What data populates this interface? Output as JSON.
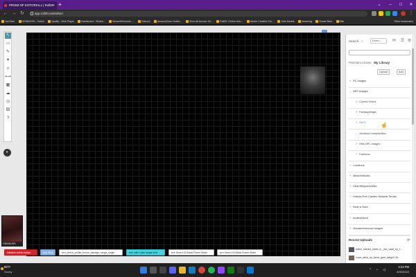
{
  "browser": {
    "tab_title": "PRISM OF KOTORIALL | Roll20",
    "tab_close": "×",
    "new_tab": "+",
    "url": "app.roll20.net/editor/",
    "window_controls": [
      "⌄",
      "–",
      "□",
      "✕"
    ],
    "nav": [
      "←",
      "→",
      "↻"
    ],
    "bookmarks": [
      "YouTube",
      "ODINKUSH - Twitch",
      "Spotify - Web Player",
      "Dashboard - Redea...",
      "StreamElements -...",
      "Discord",
      "AmazonZone Online...",
      "Xbox All Access Xb...",
      "Roll20: Online virtu...",
      "Adobe Creative Clo...",
      "Odin Assets",
      "dreaming",
      "Social Sites",
      "Bills"
    ],
    "other_bookmarks": "Other bookmarks"
  },
  "roll20": {
    "avatar_label": "ODINKUSH",
    "macros": [
      {
        "label": "initiative-roll-to-tracker",
        "style": "red"
      },
      {
        "label": "Ken Shot",
        "style": "blue"
      },
      {
        "label": "ken_check_profile_bonus_damage_range_single",
        "style": "white"
      },
      {
        "label": "Ken with Caller single shot",
        "style": "cyan"
      },
      {
        "label": "ken Sword-Of-Black-Flame-Strike",
        "style": "white"
      },
      {
        "label": "ken Sword-Of-Black-Flame-Strike",
        "style": "white"
      }
    ],
    "sidebar": {
      "search_label": "Search",
      "select_value": "Exam...",
      "premium": "Premium Assets",
      "my_library": "My Library",
      "upload": "Upload",
      "add": "Add",
      "folders": [
        {
          "label": "PC Images",
          "arrow": "+",
          "indent": 0
        },
        {
          "label": "NPC Images",
          "arrow": "–",
          "indent": 0
        },
        {
          "label": "Cosmic Horror",
          "arrow": "+",
          "indent": 1
        },
        {
          "label": "Fantasy/Magic",
          "arrow": "+",
          "indent": 1
        },
        {
          "label": "Sci Fi",
          "arrow": "+",
          "indent": 1,
          "highlight": true
        },
        {
          "label": "Vendors/Contacts/Misc",
          "arrow": "–",
          "indent": 1
        },
        {
          "label": "Rifts NPC Images",
          "arrow": "+",
          "indent": 1
        },
        {
          "label": "Fashions",
          "arrow": "+",
          "indent": 1
        },
        {
          "label": "Locations",
          "arrow": "+",
          "indent": 0
        },
        {
          "label": "Mech/Vehicles",
          "arrow": "+",
          "indent": 0
        },
        {
          "label": "Gear/Weapons/Misc",
          "arrow": "+",
          "indent": 0
        },
        {
          "label": "Hassle-Free Castles: Modular Terrain",
          "arrow": "+",
          "indent": 0
        },
        {
          "label": "Build a Town",
          "arrow": "+",
          "indent": 0
        },
        {
          "label": "bodies/blood",
          "arrow": "+",
          "indent": 0
        },
        {
          "label": "Monster/Inhuman Images",
          "arrow": "+",
          "indent": 0
        }
      ],
      "recent_title": "Recent Uploads",
      "recent_items": [
        "twitch_stream_week_6__the_vault_by_t...",
        "lunar_witch_by_kevin_glint_dafg44 35..."
      ]
    }
  },
  "taskbar": {
    "weather_temp": "86°F",
    "weather_desc": "Sunny",
    "time": "4:23 PM",
    "date": "8/30/2022"
  },
  "colors": {
    "tab_strip": "#5a1e8c",
    "macro_red": "#d7262b",
    "macro_cyan": "#43d4e0",
    "macro_blue": "#8ab3d9",
    "highlight": "#2a7ccf"
  }
}
